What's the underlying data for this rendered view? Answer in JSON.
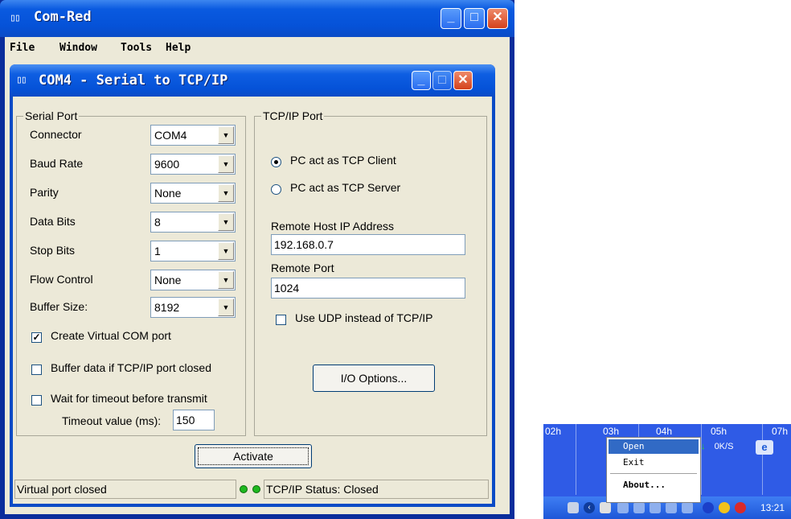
{
  "main_window": {
    "title": "Com-Red",
    "menu": [
      "File",
      "Window",
      "Tools",
      "Help"
    ]
  },
  "child_window": {
    "title": "COM4 - Serial to TCP/IP"
  },
  "serial_port": {
    "group_label": "Serial Port",
    "connector_label": "Connector",
    "connector_value": "COM4",
    "baud_label": "Baud Rate",
    "baud_value": "9600",
    "parity_label": "Parity",
    "parity_value": "None",
    "databits_label": "Data Bits",
    "databits_value": "8",
    "stopbits_label": "Stop Bits",
    "stopbits_value": "1",
    "flow_label": "Flow Control",
    "flow_value": "None",
    "buffer_label": "Buffer Size:",
    "buffer_value": "8192",
    "create_virtual_label": "Create Virtual COM port",
    "create_virtual_checked": true,
    "buffer_data_label": "Buffer data if TCP/IP port closed",
    "buffer_data_checked": false,
    "wait_timeout_label": "Wait for timeout before transmit",
    "wait_timeout_checked": false,
    "timeout_label": "Timeout value (ms):",
    "timeout_value": "150"
  },
  "tcp_port": {
    "group_label": "TCP/IP Port",
    "client_label": "PC act as TCP Client",
    "server_label": "PC act as TCP Server",
    "selected_mode": "client",
    "remote_host_label": "Remote Host IP Address",
    "remote_host_value": "192.168.0.7",
    "remote_port_label": "Remote Port",
    "remote_port_value": "1024",
    "udp_label": "Use UDP instead of TCP/IP",
    "udp_checked": false,
    "io_options_label": "I/O Options..."
  },
  "activate_label": "Activate",
  "status": {
    "left": "Virtual port closed",
    "right": "TCP/IP Status: Closed",
    "led_color": "#1fb81f"
  },
  "tray": {
    "hours": [
      "02h",
      "03h",
      "04h",
      "05h",
      "07h"
    ],
    "rate": "0K/S",
    "clock": "13:21",
    "menu": [
      "Open",
      "Exit",
      "About..."
    ]
  },
  "colors": {
    "title_blue": "#0552d8",
    "face": "#ece9d8",
    "close_red": "#d4411c"
  }
}
